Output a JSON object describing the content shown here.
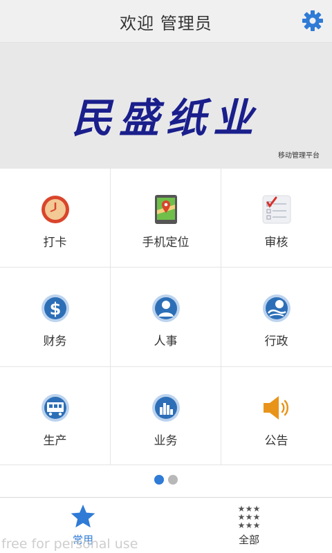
{
  "header": {
    "title": "欢迎 管理员"
  },
  "banner": {
    "brand": "民盛纸业",
    "subtitle": "移动管理平台"
  },
  "grid": [
    {
      "label": "打卡",
      "icon": "clock-icon"
    },
    {
      "label": "手机定位",
      "icon": "map-location-icon"
    },
    {
      "label": "审核",
      "icon": "checklist-icon"
    },
    {
      "label": "财务",
      "icon": "dollar-icon"
    },
    {
      "label": "人事",
      "icon": "person-icon"
    },
    {
      "label": "行政",
      "icon": "admin-icon"
    },
    {
      "label": "生产",
      "icon": "production-icon"
    },
    {
      "label": "业务",
      "icon": "bar-chart-icon"
    },
    {
      "label": "公告",
      "icon": "speaker-icon"
    }
  ],
  "pager": {
    "pages": 2,
    "current": 1
  },
  "tabbar": {
    "tabs": [
      {
        "label": "常用",
        "icon": "star-icon",
        "active": true
      },
      {
        "label": "全部",
        "icon": "stars-grid-icon",
        "active": false
      }
    ]
  },
  "watermark": "free for personal use",
  "colors": {
    "accent": "#2f7bd6",
    "brand": "#1a1f8c",
    "icon_blue": "#2d6fb7"
  }
}
